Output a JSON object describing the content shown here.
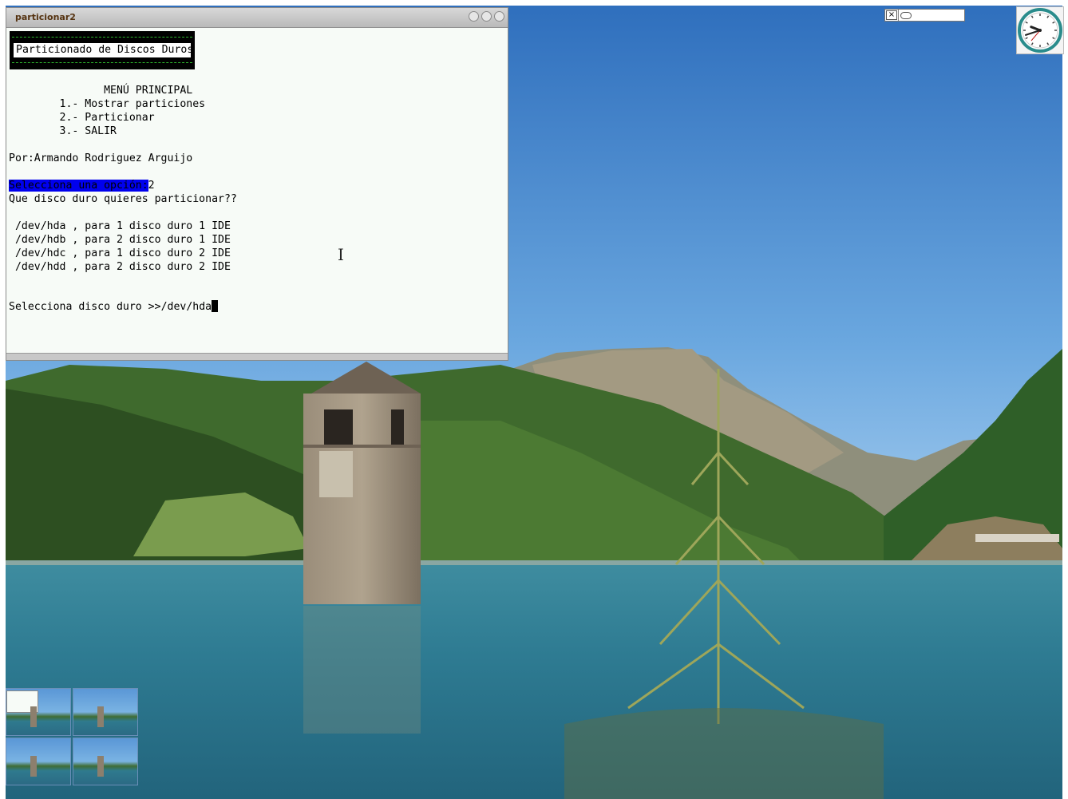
{
  "window": {
    "title": "particionar2",
    "buttons": [
      "minimize",
      "maximize",
      "close"
    ]
  },
  "terminal": {
    "banner": "Particionado de Discos Duros",
    "lines": [
      "               MENÚ PRINCIPAL",
      "        1.- Mostrar particiones",
      "        2.- Particionar",
      "        3.- SALIR",
      "",
      "Por:Armando Rodriguez Arguijo",
      ""
    ],
    "prompt_highlight": "Selecciona una opción:",
    "prompt_answer": "2",
    "question": "Que disco duro quieres particionar??",
    "disks": [
      " /dev/hda , para 1 disco duro 1 IDE",
      " /dev/hdb , para 2 disco duro 1 IDE",
      " /dev/hdc , para 1 disco duro 2 IDE",
      " /dev/hdd , para 2 disco duro 2 IDE"
    ],
    "input_prompt": "Selecciona disco duro >>",
    "input_value": "/dev/hda"
  },
  "tray": {
    "close_glyph": "×"
  },
  "clock": {
    "hour": 9,
    "minute": 42
  },
  "pager": {
    "workspaces": 4,
    "active": 1
  },
  "colors": {
    "terminal_bg": "#f7fbf7",
    "highlight": "#0000ee",
    "banner_dash": "#2eb82e",
    "title_text": "#553311"
  }
}
